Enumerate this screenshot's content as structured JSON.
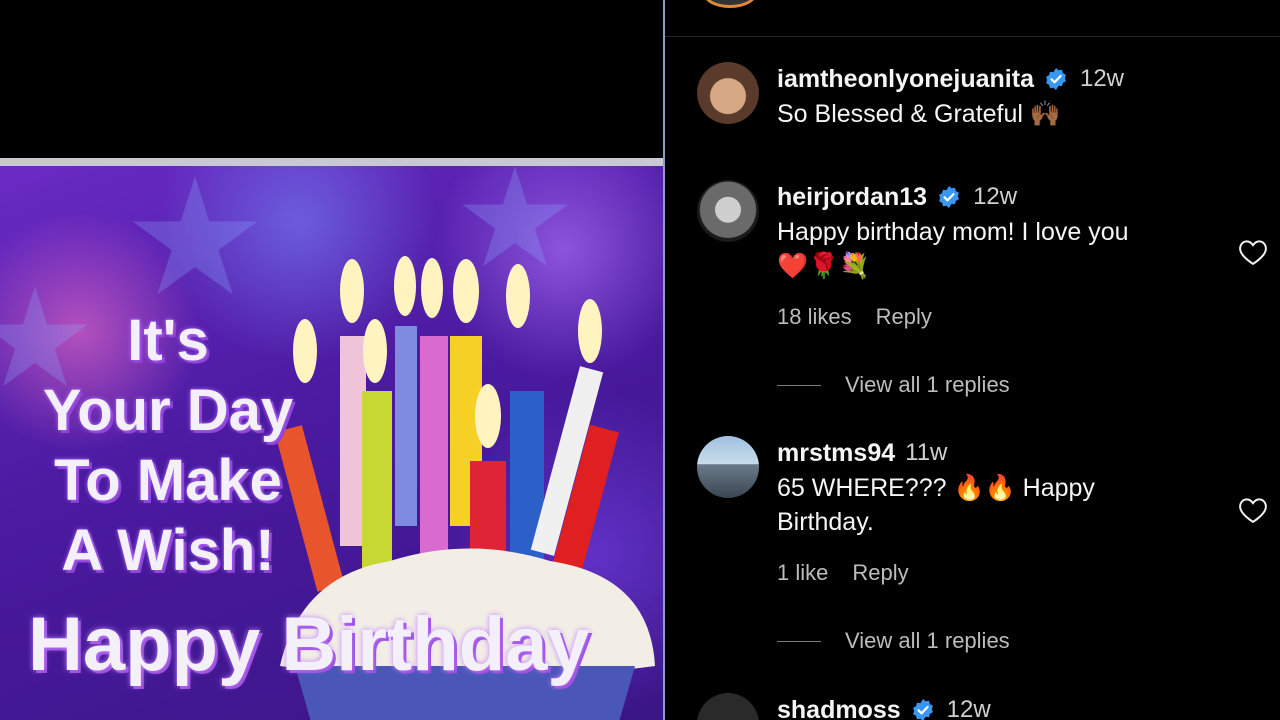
{
  "post": {
    "wish_lines": [
      "It's",
      "Your Day",
      "To Make",
      "A Wish!"
    ],
    "birthday_text": "Happy Birthday"
  },
  "comments": [
    {
      "username": "iamtheonlyonejuanita",
      "verified": true,
      "time": "12w",
      "text": "So Blessed & Grateful",
      "emoji": "🙌🏾"
    },
    {
      "username": "heirjordan13",
      "verified": true,
      "time": "12w",
      "text": "Happy birthday mom! I love you",
      "emoji": "❤️🌹💐",
      "likes": "18 likes",
      "reply_label": "Reply",
      "view_replies": "View all 1 replies"
    },
    {
      "username": "mrstms94",
      "verified": false,
      "time": "11w",
      "text": "65 WHERE??? 🔥🔥 Happy Birthday.",
      "likes": "1 like",
      "reply_label": "Reply",
      "view_replies": "View all 1 replies"
    },
    {
      "username": "shadmoss",
      "verified": true,
      "time": "12w"
    }
  ],
  "colors": {
    "verified": "#3897f0",
    "background": "#000000",
    "muted_text": "#bcbcbc"
  },
  "icons": [
    "verified-badge-icon",
    "heart-icon"
  ]
}
